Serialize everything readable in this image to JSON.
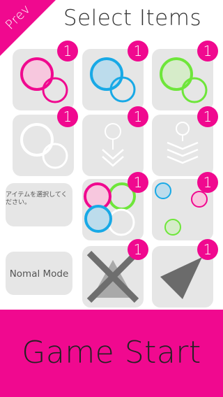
{
  "header": {
    "prev_label": "Prev",
    "title": "Select Items"
  },
  "items": [
    {
      "name": "pink-circles",
      "count": "1"
    },
    {
      "name": "blue-circles",
      "count": "1"
    },
    {
      "name": "green-circles",
      "count": "1"
    },
    {
      "name": "white-circles",
      "count": "1"
    },
    {
      "name": "chevron-down",
      "count": "1"
    },
    {
      "name": "wave-lines",
      "count": "1"
    },
    {
      "name": "mixed-circles",
      "count": "1"
    },
    {
      "name": "scattered-dots",
      "count": "1"
    },
    {
      "name": "cross-triangle",
      "count": "1"
    },
    {
      "name": "dark-triangle",
      "count": "1"
    }
  ],
  "instruction_text": "アイテムを選択してください。",
  "mode_label": "Nomal Mode",
  "start_button": {
    "label": "Game Start"
  },
  "colors": {
    "accent": "#f0098f",
    "tile": "#e6e6e6",
    "pink": "#f0098f",
    "blue": "#18a9e6",
    "green": "#6ee63a"
  }
}
